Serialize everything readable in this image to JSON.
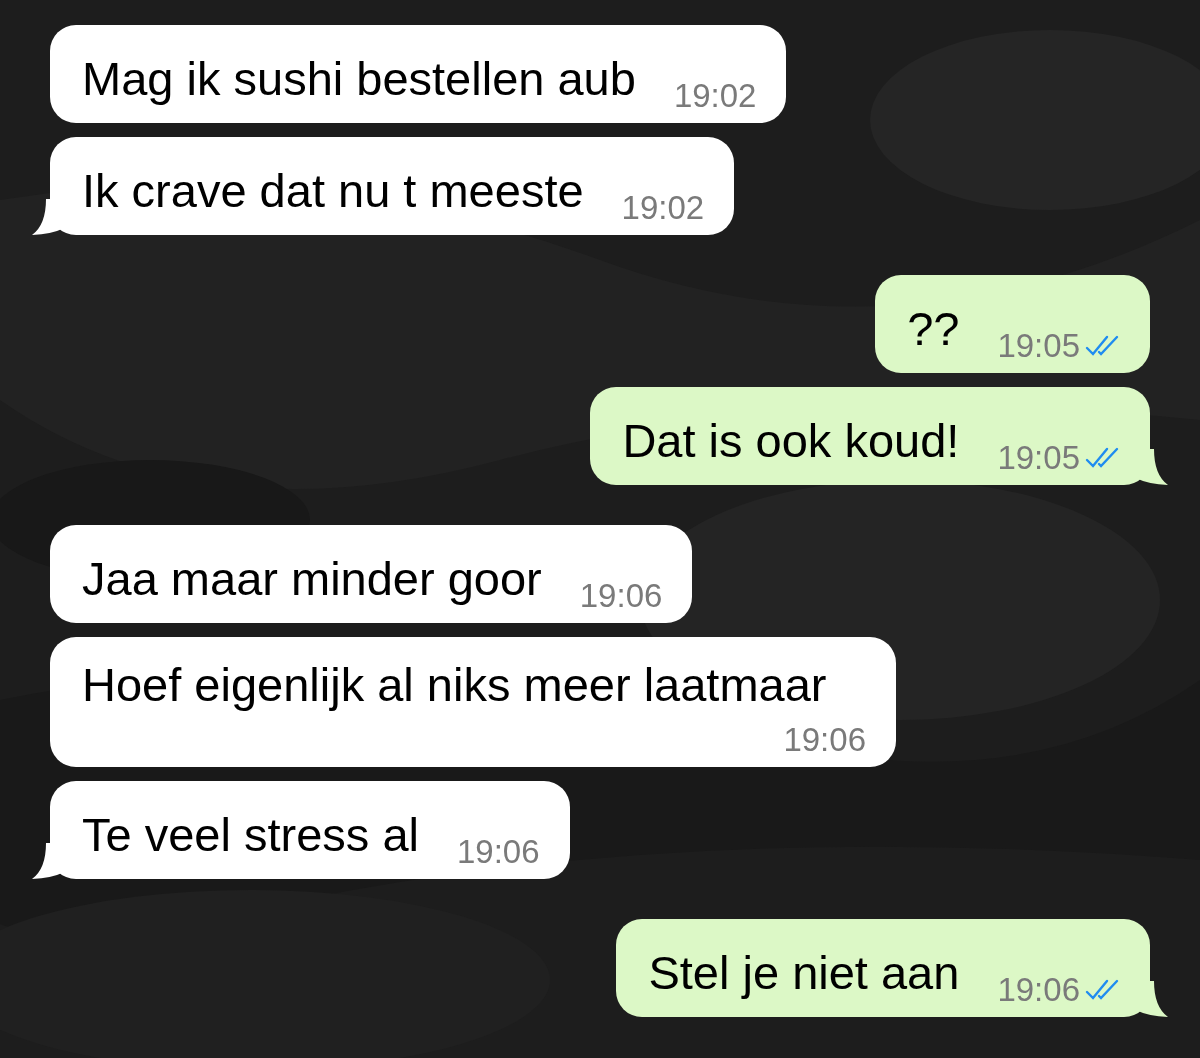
{
  "messages": [
    {
      "kind": "incoming",
      "text": "Mag ik sushi bestellen aub",
      "time": "19:02",
      "tail": false
    },
    {
      "kind": "incoming",
      "text": "Ik crave dat nu t meeste",
      "time": "19:02",
      "tail": true
    },
    {
      "kind": "outgoing",
      "text": "??",
      "time": "19:05",
      "tail": false,
      "read": true
    },
    {
      "kind": "outgoing",
      "text": "Dat is ook koud!",
      "time": "19:05",
      "tail": true,
      "read": true
    },
    {
      "kind": "incoming",
      "text": "Jaa maar minder goor",
      "time": "19:06",
      "tail": false
    },
    {
      "kind": "incoming",
      "text": "Hoef eigenlijk al niks meer laatmaar",
      "time": "19:06",
      "tail": false
    },
    {
      "kind": "incoming",
      "text": "Te veel stress al",
      "time": "19:06",
      "tail": true
    },
    {
      "kind": "outgoing",
      "text": "Stel je niet aan",
      "time": "19:06",
      "tail": true,
      "read": true
    }
  ]
}
